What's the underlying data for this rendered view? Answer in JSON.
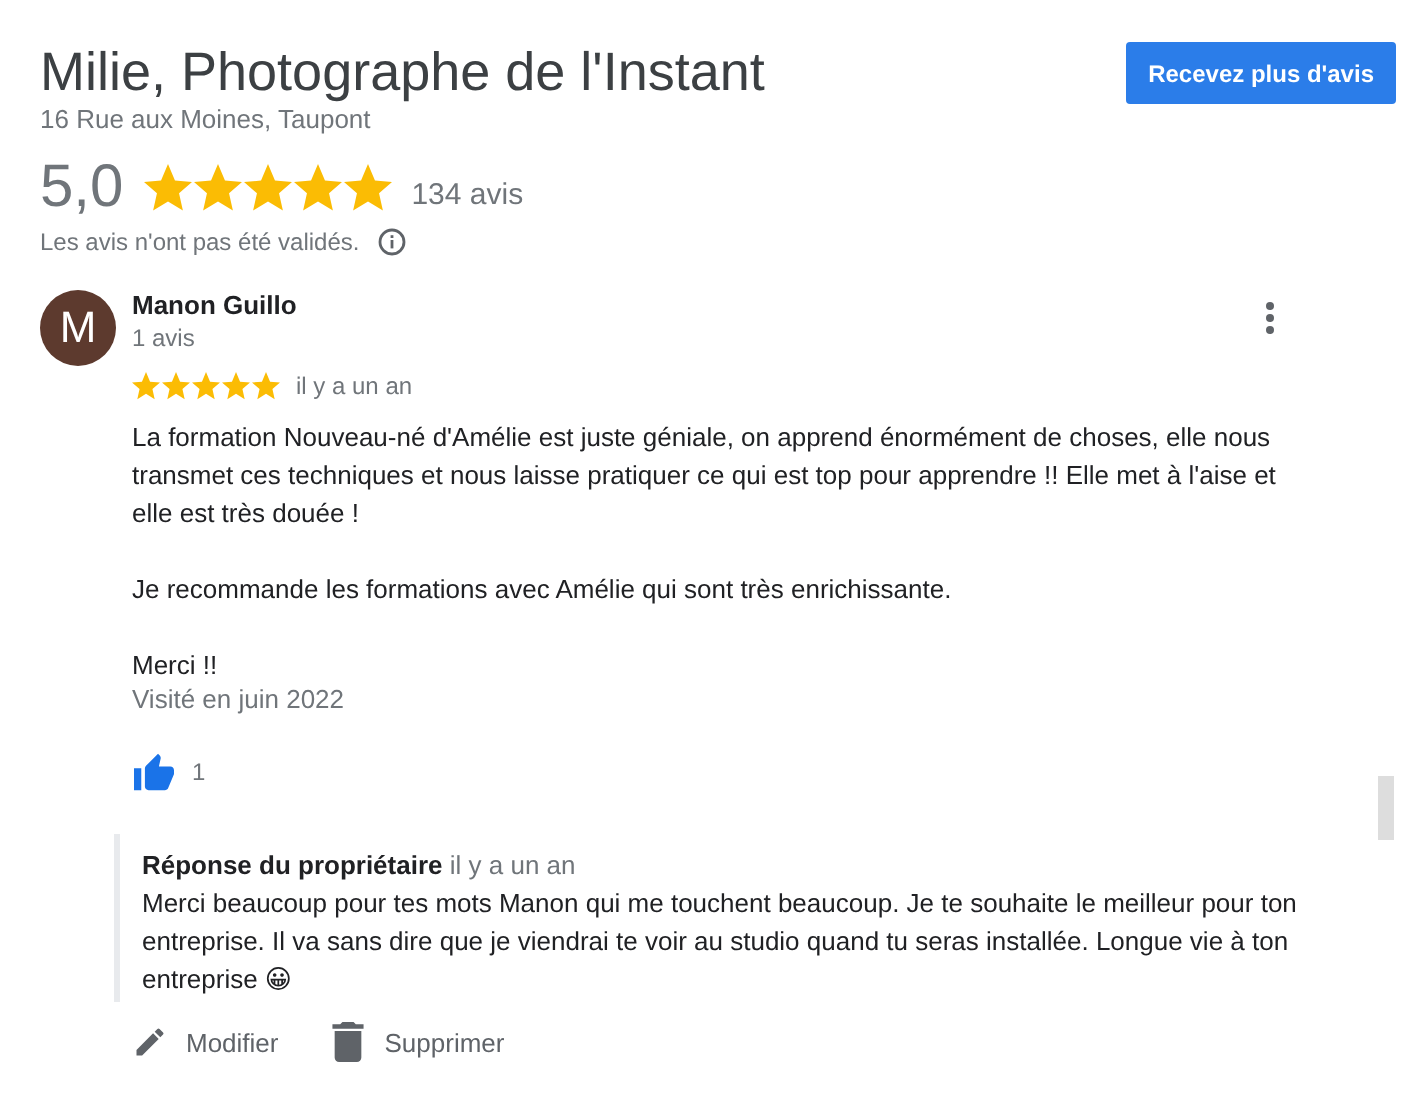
{
  "place": {
    "name": "Milie, Photographe de l'Instant",
    "address": "16 Rue aux Moines, Taupont",
    "rating": "5,0",
    "stars": 5,
    "review_count": "134 avis",
    "notice": "Les avis n'ont pas été validés.",
    "cta_button": "Recevez plus d'avis"
  },
  "review": {
    "avatar_letter": "M",
    "author": "Manon Guillo",
    "author_reviews": "1 avis",
    "stars": 5,
    "time": "il y a un an",
    "paragraphs": [
      "La formation Nouveau-né d'Amélie est juste géniale, on apprend énormément de choses, elle nous transmet ces techniques et nous laisse pratiquer ce qui est top pour apprendre !! Elle met à l'aise et elle est très douée !",
      "Je recommande les formations avec Amélie qui sont très enrichissante.",
      "Merci !!"
    ],
    "visited": "Visité en juin 2022",
    "liked": true,
    "like_count": "1",
    "owner_reply": {
      "title": "Réponse du propriétaire",
      "time": "il y a un an",
      "text": "Merci beaucoup pour tes mots Manon qui me touchent beaucoup. Je te souhaite le meilleur pour ton entreprise. Il va sans dire que je viendrai te voir au studio quand tu seras installée. Longue vie à ton entreprise 😀"
    },
    "actions": [
      {
        "kind": "edit",
        "label": "Modifier"
      },
      {
        "kind": "delete",
        "label": "Supprimer"
      }
    ]
  }
}
